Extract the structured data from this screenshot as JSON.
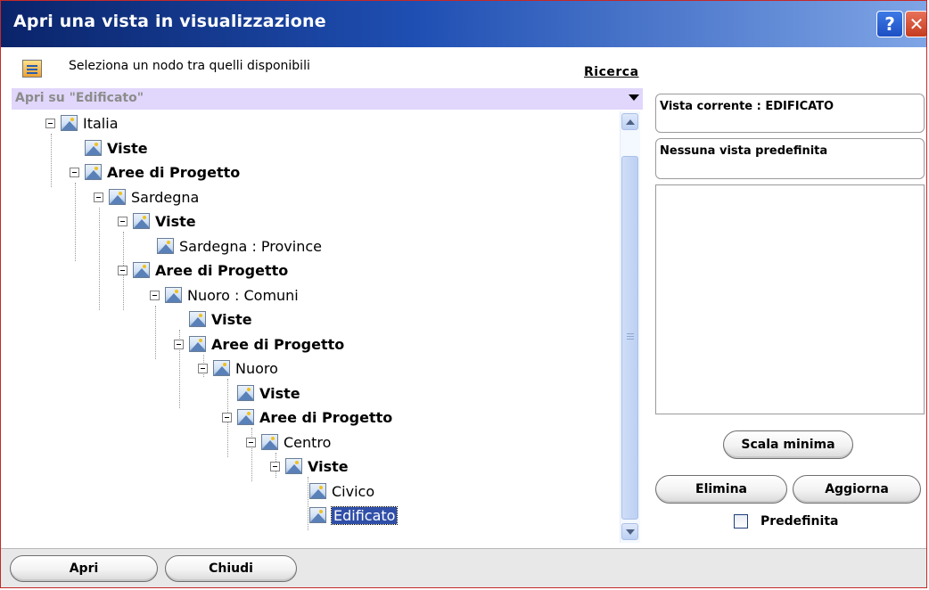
{
  "window": {
    "title": "Apri una vista in visualizzazione",
    "help_glyph": "?",
    "close_glyph": "✕"
  },
  "infobar": {
    "text": "Seleziona un nodo tra quelli disponibili",
    "search_link": "Ricerca"
  },
  "tree": {
    "header": "Apri su \"Edificato\"",
    "nodes": [
      {
        "label": "Italia",
        "bold": false
      },
      {
        "label": "Viste",
        "bold": true
      },
      {
        "label": "Aree di Progetto",
        "bold": true
      },
      {
        "label": "Sardegna",
        "bold": false
      },
      {
        "label": "Viste",
        "bold": true
      },
      {
        "label": "Sardegna : Province",
        "bold": false
      },
      {
        "label": "Aree di Progetto",
        "bold": true
      },
      {
        "label": "Nuoro : Comuni",
        "bold": false
      },
      {
        "label": "Viste",
        "bold": true
      },
      {
        "label": "Aree di Progetto",
        "bold": true
      },
      {
        "label": "Nuoro",
        "bold": false
      },
      {
        "label": "Viste",
        "bold": true
      },
      {
        "label": "Aree di Progetto",
        "bold": true
      },
      {
        "label": "Centro",
        "bold": false
      },
      {
        "label": "Viste",
        "bold": true
      },
      {
        "label": "Civico",
        "bold": false
      },
      {
        "label": "Edificato",
        "bold": false,
        "selected": true
      }
    ]
  },
  "right_panel": {
    "current_view": "Vista corrente : EDIFICATO",
    "default_view": "Nessuna vista predefinita",
    "scala_button": "Scala minima",
    "elimina_button": "Elimina",
    "aggiorna_button": "Aggiorna",
    "predefinita_label": "Predefinita",
    "predefinita_checked": false
  },
  "footer": {
    "apri_button": "Apri",
    "chiudi_button": "Chiudi"
  },
  "colors": {
    "title_start": "#0a246a",
    "title_end": "#7fa5e6",
    "tree_header_bg": "#e1d6fb",
    "selection": "#2f4fa8",
    "window_border": "#c62828"
  }
}
